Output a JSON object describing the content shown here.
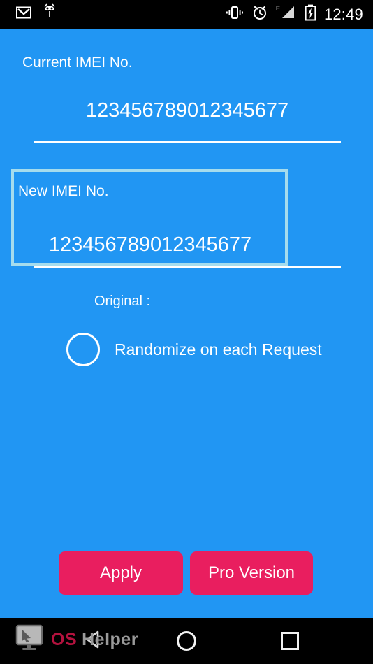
{
  "status_bar": {
    "time": "12:49",
    "left_icons": [
      {
        "name": "gmail-icon",
        "glyph": "M"
      },
      {
        "name": "android-head-icon",
        "glyph": ""
      }
    ],
    "right_icons": [
      {
        "name": "vibrate-icon"
      },
      {
        "name": "alarm-clock-icon"
      },
      {
        "name": "edge-signal-icon",
        "glyph": "E"
      },
      {
        "name": "battery-charging-icon"
      }
    ],
    "background_color": "#000000"
  },
  "screen": {
    "background_color": "#2196f3",
    "accent_color": "#e91e5f",
    "focus_border_color": "#a5dced",
    "text_color": "#ffffff"
  },
  "current_imei": {
    "label": "Current IMEI No.",
    "value": "123456789012345677"
  },
  "new_imei": {
    "label": "New IMEI No.",
    "value": "123456789012345677",
    "focused": true
  },
  "original": {
    "label": "Original :",
    "value": ""
  },
  "randomize": {
    "label": "Randomize on each Request",
    "checked": false
  },
  "buttons": {
    "apply": "Apply",
    "pro_version": "Pro Version"
  },
  "nav_bar": {
    "back": "back-triangle-icon",
    "home": "home-circle-icon",
    "recents": "recents-square-icon",
    "background_color": "#000000"
  },
  "watermark": {
    "icon": "monitor-cursor-icon",
    "text_primary": "OS",
    "text_secondary": "Helper",
    "primary_color": "#b3123e",
    "secondary_color": "#9a9a9a"
  }
}
